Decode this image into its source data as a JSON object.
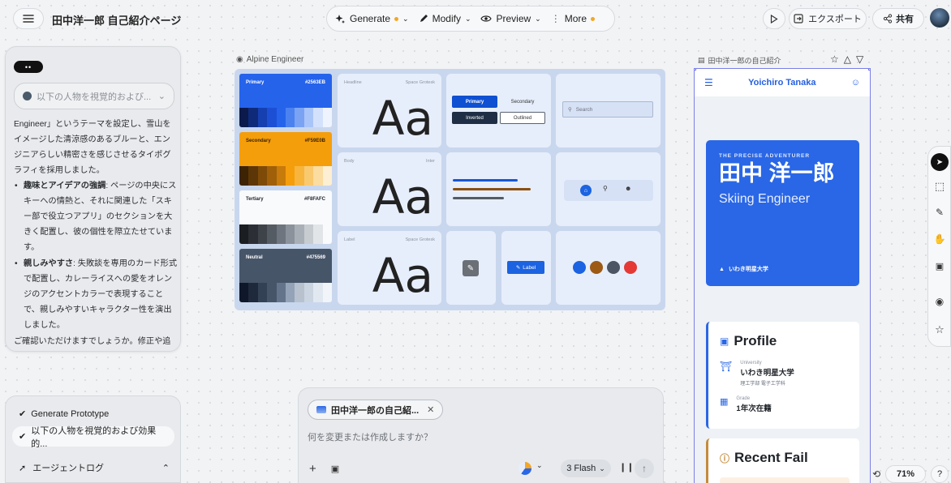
{
  "header": {
    "title": "田中洋一郎 自己紹介ページ",
    "toolbar": [
      {
        "label": "Generate",
        "icon": "sparkle-icon",
        "has_dot": true
      },
      {
        "label": "Modify",
        "icon": "pen-icon",
        "has_dot": false
      },
      {
        "label": "Preview",
        "icon": "eye-icon",
        "has_dot": false
      },
      {
        "label": "More",
        "icon": "kebab-icon",
        "has_dot": true
      }
    ],
    "export_label": "エクスポート",
    "share_label": "共有"
  },
  "chat": {
    "badge": "••",
    "dropdown_text": "以下の人物を視覚的および...",
    "intro_text": "Engineer」というテーマを設定し、雪山をイメージした清涼感のあるブルーと、エンジニアらしい精密さを感じさせるタイポグラフィを採用しました。",
    "bullets": [
      {
        "title": "趣味とアイデアの強調",
        "text": ": ページの中央にスキーへの情熱と、それに関連した「スキー部で役立つアプリ」のセクションを大きく配置し、彼の個性を際立たせています。"
      },
      {
        "title": "親しみやすさ",
        "text": ": 失敗談を専用のカード形式で配置し、カレーライスへの愛をオレンジのアクセントカラーで表現することで、親しみやすいキャラクター性を演出しました。"
      }
    ],
    "closing": "ご確認いただけますでしょうか。修正や追加したい内容があればお知らせください。"
  },
  "history": {
    "items": [
      "Generate Prototype",
      "以下の人物を視覚的および効果的..."
    ],
    "agent_log": "エージェントログ"
  },
  "design_system": {
    "label": "Alpine Engineer",
    "swatches": [
      {
        "name": "Primary",
        "hex": "#2563EB",
        "bg": "#2563eb",
        "fg": "#ffffff",
        "scale": [
          "#0b1a4a",
          "#0f2a78",
          "#163fb0",
          "#1d4fd4",
          "#2563eb",
          "#4b82f0",
          "#7aa3f4",
          "#a9c4f8",
          "#d3e1fc",
          "#eef3fe"
        ]
      },
      {
        "name": "Secondary",
        "hex": "#F59E0B",
        "bg": "#f59e0b",
        "fg": "#3a2300",
        "scale": [
          "#3b2304",
          "#5c3606",
          "#7d4a08",
          "#a0600a",
          "#c77b0a",
          "#f59e0b",
          "#f7b53e",
          "#f9c96f",
          "#fbdca1",
          "#fdefd3"
        ]
      },
      {
        "name": "Tertiary",
        "hex": "#F8FAFC",
        "bg": "#f8fafc",
        "fg": "#1f2328",
        "scale": [
          "#1a1d21",
          "#2b2f35",
          "#3e434a",
          "#555b63",
          "#6e757e",
          "#8b929b",
          "#a9afb6",
          "#c7ccd1",
          "#e2e5e8",
          "#f8fafc"
        ]
      },
      {
        "name": "Neutral",
        "hex": "#475569",
        "bg": "#475569",
        "fg": "#ffffff",
        "scale": [
          "#0f172a",
          "#1e293b",
          "#334155",
          "#475569",
          "#64748b",
          "#94a3b8",
          "#b8c2cf",
          "#cbd5e1",
          "#e2e8f0",
          "#f1f5f9"
        ]
      }
    ],
    "type_specimens": [
      {
        "role": "Headline",
        "font": "Space Grotesk",
        "sample": "Aa"
      },
      {
        "role": "Body",
        "font": "Inter",
        "sample": "Aa"
      },
      {
        "role": "Label",
        "font": "Space Grotesk",
        "sample": "Aa"
      }
    ],
    "buttons": {
      "primary": "Primary",
      "secondary": "Secondary",
      "inverted": "Inverted",
      "outlined": "Outlined"
    },
    "search_placeholder": "Search",
    "label_chip": "Label",
    "colors": {
      "board": "#c9d7ee",
      "card": "#e7eefb",
      "brand": "#2a67e6",
      "orange": "#9c5a14",
      "red": "#e53935"
    }
  },
  "mobile_preview": {
    "label": "田中洋一郎の自己紹介",
    "brand": "Yoichiro Tanaka",
    "hero": {
      "tag": "THE PRECISE ADVENTURER",
      "name": "田中 洋一郎",
      "subtitle": "Skiing Engineer",
      "school": "いわき明星大学"
    },
    "profile": {
      "title": "Profile",
      "rows": [
        {
          "key": "University",
          "value": "いわき明星大学",
          "sub": "理工学部 電子工学科",
          "icon": "bank-icon"
        },
        {
          "key": "Grade",
          "value": "1年次在籍",
          "sub": "",
          "icon": "calendar-icon"
        }
      ]
    },
    "recent_fail_title": "Recent Fail"
  },
  "composer": {
    "context_chip": "田中洋一郎の自己紹...",
    "placeholder": "何を変更または作成しますか？",
    "model": "3 Flash"
  },
  "zoom": {
    "level": "71%",
    "help": "?"
  }
}
